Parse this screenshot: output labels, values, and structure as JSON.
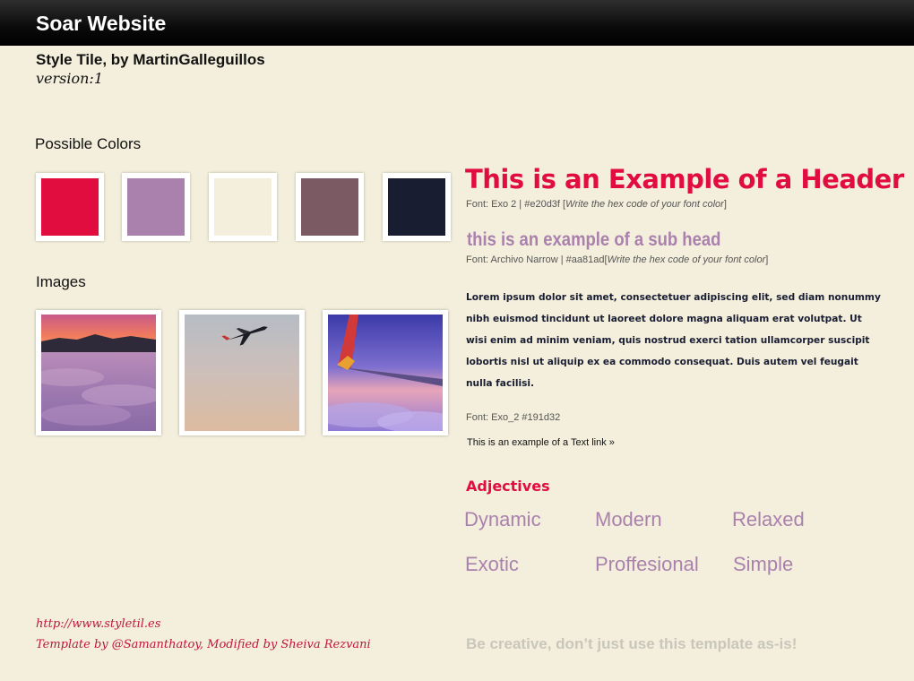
{
  "header": {
    "site_title": "Soar Website"
  },
  "intro": {
    "tile_title": "Style Tile, by MartinGalleguillos",
    "version": "version:1"
  },
  "colors_section": {
    "label": "Possible Colors",
    "swatches": [
      "#e20d3f",
      "#aa81ad",
      "#f3efdc",
      "#7c5a64",
      "#191d32"
    ]
  },
  "images_section": {
    "label": "Images",
    "images": [
      "cloud-sunset-icon",
      "airplane-sky-icon",
      "airplane-wing-icon"
    ]
  },
  "typography": {
    "header_text": "This is an Example of a Header",
    "header_color": "#e20d3f",
    "header_meta_font": "Font: Exo 2  |  #e20d3f [",
    "header_meta_note": "Write the hex code of your font color",
    "header_meta_end": "]",
    "subhead_text": "this is an example of a sub head",
    "subhead_color": "#aa81ad",
    "subhead_meta_font": "Font: Archivo Narrow  |  #aa81ad[",
    "subhead_meta_note": "Write the hex code of your font color",
    "subhead_meta_end": "]",
    "body_text": "Lorem ipsum dolor sit amet, consectetuer adipiscing elit, sed diam nonummy nibh euismod tincidunt ut laoreet dolore magna aliquam erat volutpat. Ut wisi enim ad minim veniam, quis nostrud exerci tation ullamcorper suscipit lobortis nisl ut aliquip ex ea commodo consequat. Duis autem vel feugait nulla facilisi.",
    "body_meta": "Font: Exo_2 #191d32",
    "link_text": "This is an example of a Text link »"
  },
  "adjectives": {
    "title": "Adjectives",
    "title_color": "#e20d3f",
    "word_color": "#aa81ad",
    "words": [
      "Dynamic",
      "Modern",
      "Relaxed",
      "Exotic",
      "Proffesional",
      "Simple"
    ]
  },
  "footer": {
    "url": "http://www.styletil.es",
    "credit": "Template by @Samanthatoy, Modified by Sheiva Rezvani",
    "color": "#c0163d",
    "tagline": "Be creative, don’t just use this template as-is!"
  }
}
